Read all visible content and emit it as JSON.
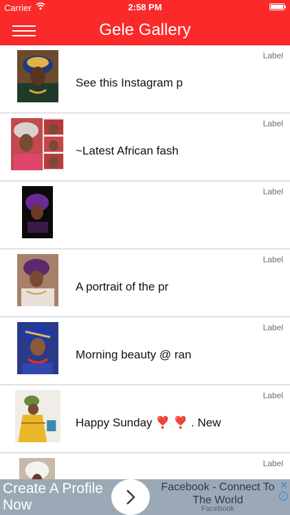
{
  "status_bar": {
    "carrier": "Carrier",
    "time": "2:58 PM"
  },
  "nav": {
    "title": "Gele Gallery"
  },
  "rows": [
    {
      "title": "See this Instagram p",
      "label": "Label"
    },
    {
      "title": "~Latest African fash",
      "label": "Label"
    },
    {
      "title": "",
      "label": "Label"
    },
    {
      "title": "A portrait of the pr",
      "label": "Label"
    },
    {
      "title": "Morning beauty @ ran",
      "label": "Label"
    },
    {
      "title": "Happy Sunday ❣️ ❣️ . New",
      "label": "Label"
    },
    {
      "title": "",
      "label": "Label"
    }
  ],
  "ad": {
    "headline": "Create A Profile Now",
    "text": "Facebook - Connect To The World",
    "source": "Facebook",
    "close": "✕",
    "info": "i"
  },
  "colors": {
    "brand_red": "#fa2a2a",
    "ad_bg": "#9aa9b5",
    "divider": "#c9c9c9"
  },
  "icons": [
    "wifi-icon",
    "battery-icon",
    "hamburger-menu-icon",
    "chevron-right-icon",
    "close-icon",
    "info-icon"
  ]
}
